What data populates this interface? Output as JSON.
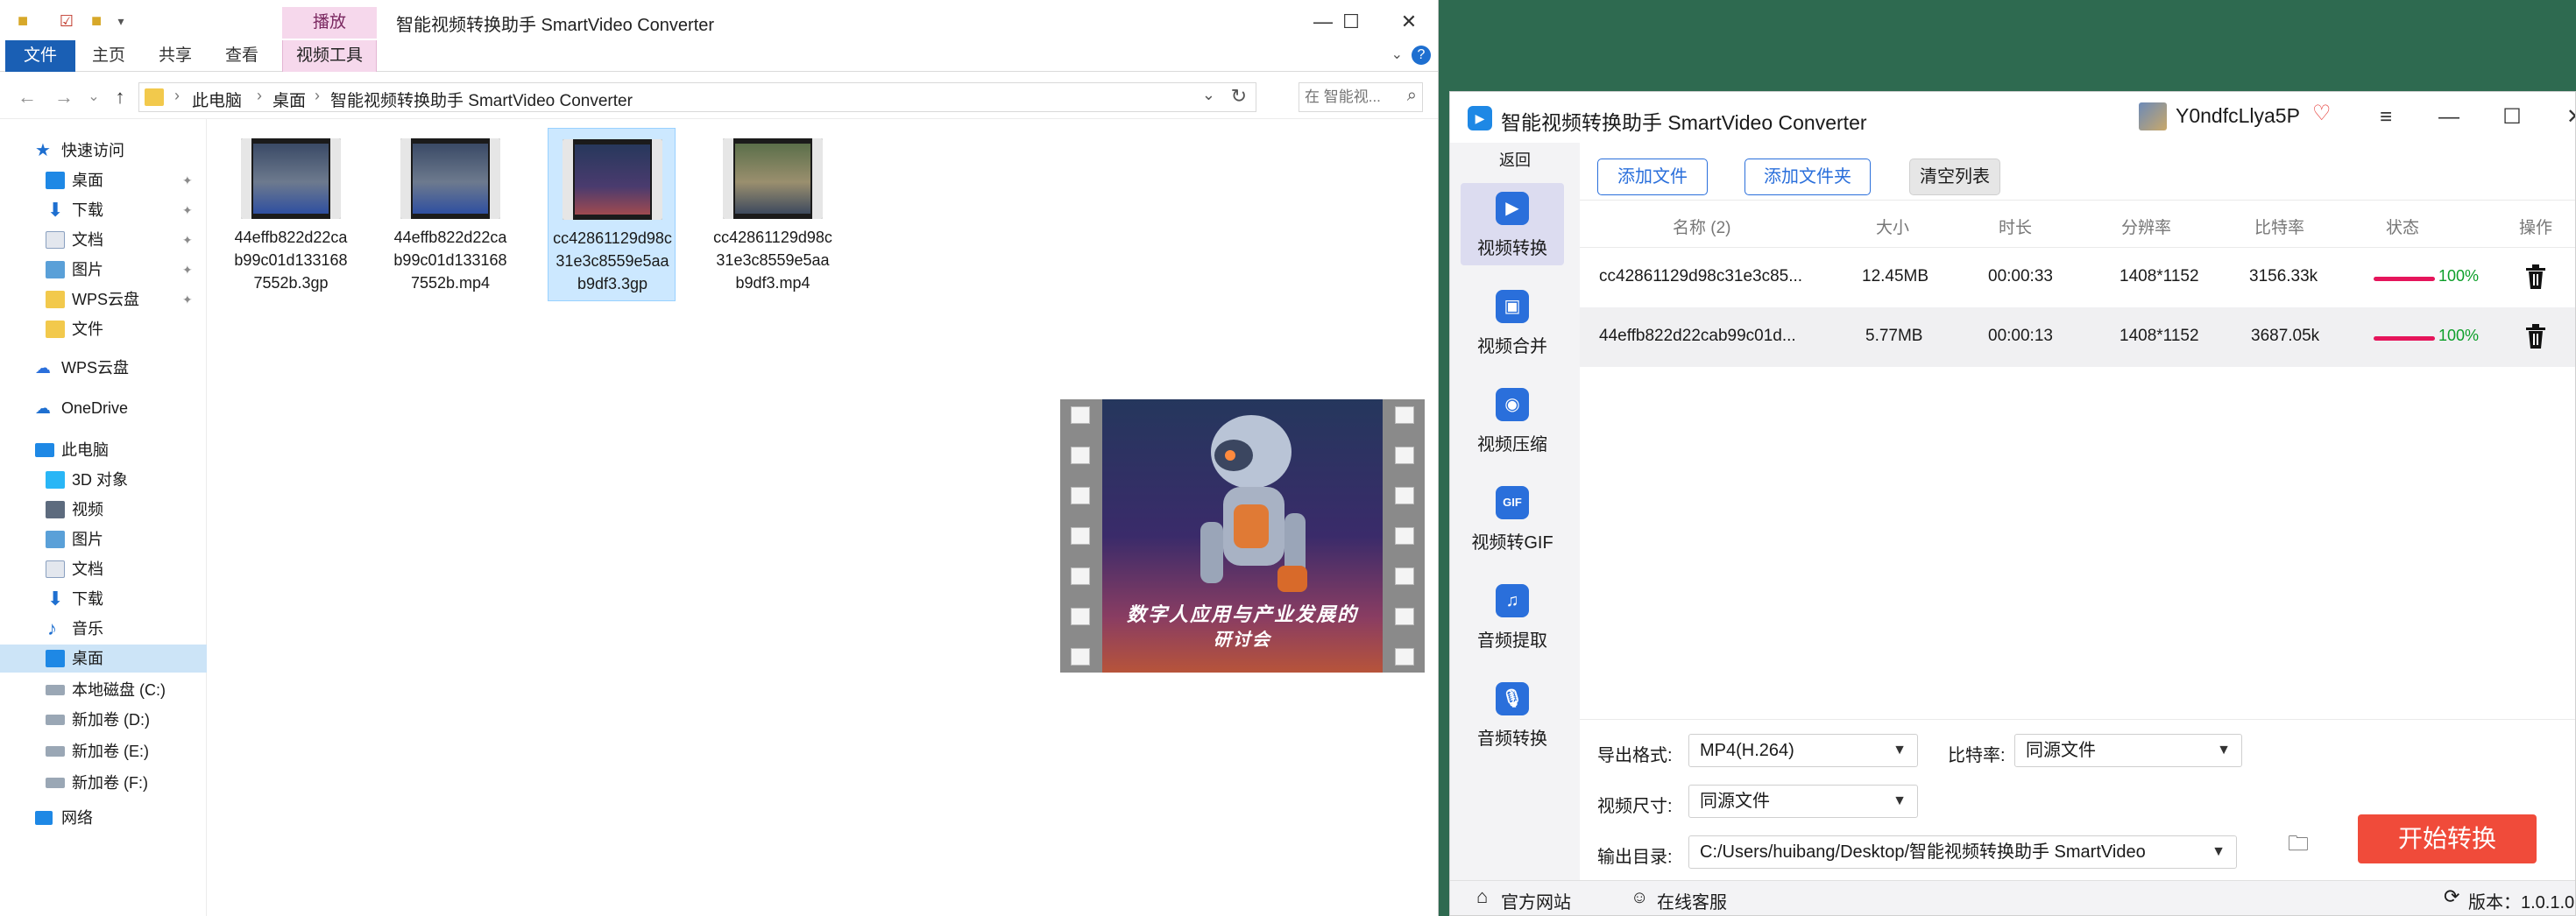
{
  "explorer": {
    "window_title": "智能视频转换助手 SmartVideo Converter",
    "ribbon": {
      "context_group": "播放",
      "tabs": [
        "文件",
        "主页",
        "共享",
        "查看",
        "视频工具"
      ]
    },
    "address": {
      "crumbs": [
        "此电脑",
        "桌面",
        "智能视频转换助手 SmartVideo Converter"
      ]
    },
    "search_placeholder": "在 智能视...",
    "nav": {
      "quick_access": "快速访问",
      "pinned": [
        "桌面",
        "下载",
        "文档",
        "图片",
        "WPS云盘",
        "文件"
      ],
      "wps": "WPS云盘",
      "onedrive": "OneDrive",
      "this_pc": "此电脑",
      "pc_items": [
        "3D 对象",
        "视频",
        "图片",
        "文档",
        "下载",
        "音乐",
        "桌面"
      ],
      "drives": [
        "本地磁盘 (C:)",
        "新加卷 (D:)",
        "新加卷 (E:)",
        "新加卷 (F:)"
      ],
      "network": "网络"
    },
    "files": [
      {
        "name": "44effb822d22cab99c01d1331687552b.3gp"
      },
      {
        "name": "44effb822d22cab99c01d1331687552b.mp4"
      },
      {
        "name": "cc42861129d98c31e3c8559e5aab9df3.3gp"
      },
      {
        "name": "cc42861129d98c31e3c8559e5aab9df3.mp4"
      }
    ],
    "preview_caption": {
      "line1": "数字人应用与产业发展的",
      "line2": "研讨会"
    }
  },
  "app": {
    "title": "智能视频转换助手 SmartVideo Converter",
    "username": "Y0ndfcLlya5P",
    "back": "返回",
    "sidebar": [
      "视频转换",
      "视频合并",
      "视频压缩",
      "视频转GIF",
      "音频提取",
      "音频转换"
    ],
    "toolbar": {
      "add_file": "添加文件",
      "add_folder": "添加文件夹",
      "clear_list": "清空列表"
    },
    "table": {
      "headers": [
        "名称 (2)",
        "大小",
        "时长",
        "分辨率",
        "比特率",
        "状态",
        "操作"
      ],
      "rows": [
        {
          "name": "cc42861129d98c31e3c85...",
          "size": "12.45MB",
          "duration": "00:00:33",
          "resolution": "1408*1152",
          "bitrate": "3156.33k",
          "progress": 100,
          "status": "100%"
        },
        {
          "name": "44effb822d22cab99c01d...",
          "size": "5.77MB",
          "duration": "00:00:13",
          "resolution": "1408*1152",
          "bitrate": "3687.05k",
          "progress": 100,
          "status": "100%"
        }
      ]
    },
    "settings": {
      "format_label": "导出格式:",
      "format_value": "MP4(H.264)",
      "bitrate_label": "比特率:",
      "bitrate_value": "同源文件",
      "size_label": "视频尺寸:",
      "size_value": "同源文件",
      "output_label": "输出目录:",
      "output_value": "C:/Users/huibang/Desktop/智能视频转换助手 SmartVideo"
    },
    "start": "开始转换",
    "status": {
      "website": "官方网站",
      "support": "在线客服",
      "version": "版本：1.0.1.0"
    },
    "colors": {
      "accent": "#2a6fdb",
      "start": "#f04b3a",
      "progress": "#e5155b",
      "done": "#0e9f2a"
    }
  }
}
